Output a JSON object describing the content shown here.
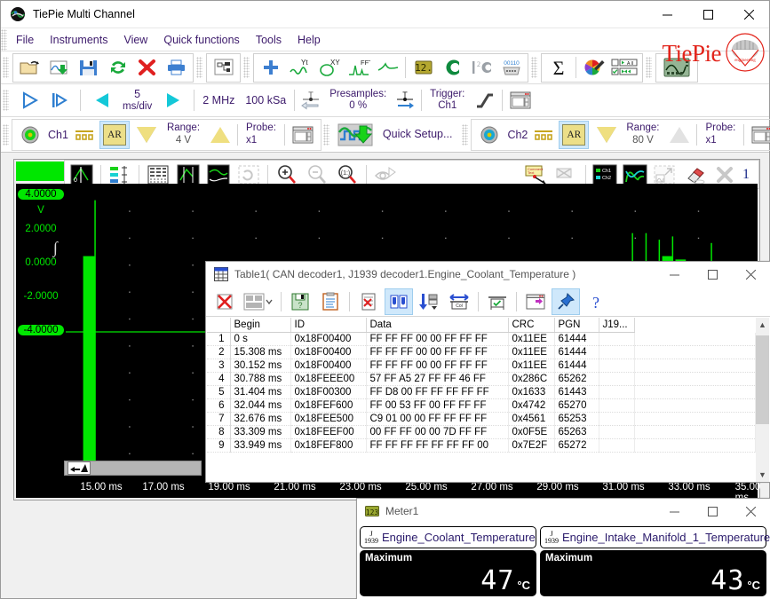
{
  "window": {
    "title": "TiePie Multi Channel",
    "minimize": "─",
    "maximize": "□",
    "close": "✕"
  },
  "menu": {
    "items": [
      "File",
      "Instruments",
      "View",
      "Quick functions",
      "Tools",
      "Help"
    ]
  },
  "brand": {
    "name": "TiePie",
    "sub": "engineering"
  },
  "toolbar_main": {
    "icons": [
      "open-icon",
      "save-as-measurement-icon",
      "save-icon",
      "refresh-icon",
      "delete-icon",
      "print-icon",
      "object-tree-icon",
      "add-icon",
      "yt-graph-icon",
      "xy-graph-icon",
      "fft-graph-icon",
      "sweep-icon",
      "meter-icon",
      "c-decoder-icon",
      "i2c-decoder-icon",
      "serial-decoder-icon",
      "sum-icon",
      "color-icon",
      "display-list-icon",
      "instrument-icon"
    ]
  },
  "acquisition": {
    "play_icon": "play-icon",
    "step_icon": "single-step-icon",
    "prev_icon": "prev-icon",
    "next_icon": "next-icon",
    "timebase_value": "5",
    "timebase_unit": "ms/div",
    "sample_rate": "2 MHz",
    "record_length": "100 kSa",
    "presamples_label": "Presamples:",
    "presamples_value": "0 %",
    "trigger_label": "Trigger:",
    "trigger_value": "Ch1",
    "trigger_slope_icon": "rising-edge-icon",
    "settings_icon": "settings-window-icon"
  },
  "channels": [
    {
      "name": "Ch1",
      "coupling_icon": "dc-coupling-icon",
      "autorange": "AR",
      "range_label": "Range:",
      "range_value": "4 V",
      "probe_label": "Probe:",
      "probe_value": "x1",
      "down_enabled": true,
      "up_enabled": true
    },
    {
      "name": "Ch2",
      "coupling_icon": "dc-coupling-icon",
      "autorange": "AR",
      "range_label": "Range:",
      "range_value": "80 V",
      "probe_label": "Probe:",
      "probe_value": "x1",
      "down_enabled": true,
      "up_enabled": false
    }
  ],
  "quick_setup": {
    "label": "Quick Setup...",
    "icon": "quick-setup-icon"
  },
  "graph_toolbar": {
    "icons": [
      "cursor-icon",
      "channel-legend-icon",
      "table-icon",
      "peak-icon",
      "envelope-icon",
      "refresh-view-icon",
      "zoom-in-icon",
      "zoom-out-icon",
      "zoom-reset-icon",
      "hide-icon"
    ],
    "right_icons": [
      "comment-icon",
      "no-comment-icon",
      "channel-select-icon",
      "curve-icon",
      "export-icon",
      "eraser-icon",
      "close-graph-icon"
    ],
    "graph_number": "1"
  },
  "chart_data": {
    "type": "line",
    "title": "",
    "xlabel": "",
    "ylabel": "V",
    "ylim": [
      -4.5,
      4.5
    ],
    "xlim": [
      14.0,
      36.0
    ],
    "y_ticks": [
      "4.0000",
      "2.0000",
      "0.0000",
      "-2.0000",
      "-4.0000"
    ],
    "y_tick_values": [
      4.0,
      2.0,
      0.0,
      -2.0,
      -4.0
    ],
    "y_unit": "V",
    "x_ticks": [
      "15.00 ms",
      "17.00 ms",
      "19.00 ms",
      "21.00 ms",
      "23.00 ms",
      "25.00 ms",
      "27.00 ms",
      "29.00 ms",
      "31.00 ms",
      "33.00 ms",
      "35.00 ms"
    ],
    "x_tick_values": [
      15,
      17,
      19,
      21,
      23,
      25,
      27,
      29,
      31,
      33,
      35
    ],
    "grid": true,
    "background": "#000000",
    "trace_color": "#00e700",
    "series": [
      {
        "name": "Ch1",
        "color": "#00e700",
        "description": "CAN bus digital burst: one packet burst near 14.7 ms and a group of 8 packets from 31.2 ms to 34.4 ms",
        "bursts": [
          {
            "start_ms": 14.55,
            "end_ms": 14.95,
            "low": -4.2,
            "high": 2.3,
            "spike_high": 4.0
          },
          {
            "start_ms": 31.2,
            "end_ms": 31.55,
            "low": -4.2,
            "high": 2.1
          },
          {
            "start_ms": 31.62,
            "end_ms": 31.95,
            "low": -4.2,
            "high": 2.1,
            "spike_high": 3.0
          },
          {
            "start_ms": 32.03,
            "end_ms": 32.38,
            "low": -4.2,
            "high": 2.1,
            "spike_high": 3.0
          },
          {
            "start_ms": 32.45,
            "end_ms": 32.8,
            "low": -4.2,
            "high": 2.1,
            "spike_high": 2.8
          },
          {
            "start_ms": 32.87,
            "end_ms": 33.22,
            "low": -4.2,
            "high": 2.3,
            "spike_high": 2.9
          },
          {
            "start_ms": 33.29,
            "end_ms": 33.62,
            "low": -4.2,
            "high": 2.2
          },
          {
            "start_ms": 33.7,
            "end_ms": 34.05,
            "low": -4.2,
            "high": 2.1
          },
          {
            "start_ms": 34.12,
            "end_ms": 34.45,
            "low": -4.2,
            "high": 2.1,
            "spike_high": 2.7
          }
        ],
        "baseline": 0.0
      }
    ]
  },
  "table_window": {
    "title": "Table1( CAN decoder1, J1939 decoder1.Engine_Coolant_Temperature )",
    "icon": "table-window-icon",
    "minimize": "─",
    "maximize": "□",
    "close": "✕",
    "toolbar_icons": [
      "delete-table-icon",
      "layout-icon",
      "layout-dropdown-icon",
      "save-icon",
      "copy-icon",
      "clear-icon",
      "columns-icon",
      "sort-icon",
      "autofit-icon",
      "check-columns-icon",
      "export-icon",
      "pin-icon",
      "help-icon"
    ],
    "columns": [
      "",
      "Begin",
      "ID",
      "Data",
      "CRC",
      "PGN",
      "J19..."
    ],
    "rows": [
      [
        "1",
        "0 s",
        "0x18F00400",
        "FF FF FF 00 00 FF FF FF",
        "0x11EE",
        "61444",
        ""
      ],
      [
        "2",
        "15.308 ms",
        "0x18F00400",
        "FF FF FF 00 00 FF FF FF",
        "0x11EE",
        "61444",
        ""
      ],
      [
        "3",
        "30.152 ms",
        "0x18F00400",
        "FF FF FF 00 00 FF FF FF",
        "0x11EE",
        "61444",
        ""
      ],
      [
        "4",
        "30.788 ms",
        "0x18FEEE00",
        "57 FF A5 27 FF FF 46 FF",
        "0x286C",
        "65262",
        ""
      ],
      [
        "5",
        "31.404 ms",
        "0x18F00300",
        "FF D8 00 FF FF FF FF FF",
        "0x1633",
        "61443",
        ""
      ],
      [
        "6",
        "32.044 ms",
        "0x18FEF600",
        "FF 00 53 FF 00 FF FF FF",
        "0x4742",
        "65270",
        ""
      ],
      [
        "7",
        "32.676 ms",
        "0x18FEE500",
        "C9 01 00 00 FF FF FF FF",
        "0x4561",
        "65253",
        ""
      ],
      [
        "8",
        "33.309 ms",
        "0x18FEEF00",
        "00 FF FF 00 00 7D FF FF",
        "0x0F5E",
        "65263",
        ""
      ],
      [
        "9",
        "33.949 ms",
        "0x18FEF800",
        "FF FF FF FF FF FF FF 00",
        "0x7E2F",
        "65272",
        ""
      ]
    ]
  },
  "meter_window": {
    "title": "Meter1",
    "icon": "meter-window-icon",
    "minimize": "─",
    "maximize": "□",
    "close": "✕",
    "meters": [
      {
        "source_icon": "j1939-icon",
        "source_top": "J",
        "source_bottom": "1939",
        "name": "Engine_Coolant_Temperature",
        "stat_label": "Maximum",
        "value": "47",
        "unit": "°C"
      },
      {
        "source_icon": "j1939-icon",
        "source_top": "J",
        "source_bottom": "1939",
        "name": "Engine_Intake_Manifold_1_Temperature",
        "stat_label": "Maximum",
        "value": "43",
        "unit": "°C"
      }
    ]
  }
}
